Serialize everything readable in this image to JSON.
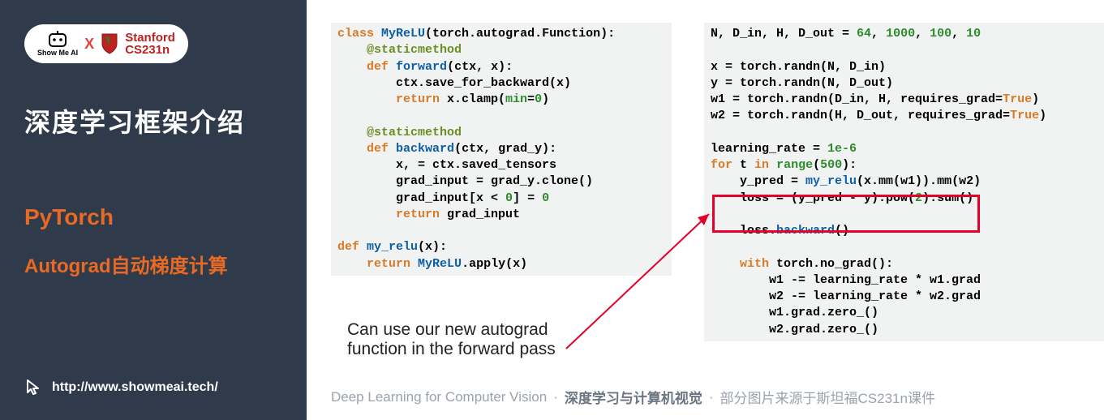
{
  "sidebar": {
    "badge": {
      "ai_small": "Show Me AI",
      "x": "X",
      "stanford_top": "Stanford",
      "stanford_bottom": "CS231n"
    },
    "title_cn": "深度学习框架介绍",
    "subtitle1": "PyTorch",
    "subtitle2": "Autograd自动梯度计算",
    "url": "http://www.showmeai.tech/"
  },
  "code_left": "class MyReLU(torch.autograd.Function):\n    @staticmethod\n    def forward(ctx, x):\n        ctx.save_for_backward(x)\n        return x.clamp(min=0)\n\n    @staticmethod\n    def backward(ctx, grad_y):\n        x, = ctx.saved_tensors\n        grad_input = grad_y.clone()\n        grad_input[x < 0] = 0\n        return grad_input\n\ndef my_relu(x):\n    return MyReLU.apply(x)",
  "code_right": "N, D_in, H, D_out = 64, 1000, 100, 10\n\nx = torch.randn(N, D_in)\ny = torch.randn(N, D_out)\nw1 = torch.randn(D_in, H, requires_grad=True)\nw2 = torch.randn(H, D_out, requires_grad=True)\n\nlearning_rate = 1e-6\nfor t in range(500):\n    y_pred = my_relu(x.mm(w1)).mm(w2)\n    loss = (y_pred - y).pow(2).sum()\n\n    loss.backward()\n\n    with torch.no_grad():\n        w1 -= learning_rate * w1.grad\n        w2 -= learning_rate * w2.grad\n        w1.grad.zero_()\n        w2.grad.zero_()",
  "caption_line1": "Can use our new autograd",
  "caption_line2": "function in the forward pass",
  "credits": {
    "c1": "Deep Learning for Computer Vision",
    "c2": "深度学习与计算机视觉",
    "c3": "部分图片来源于斯坦福CS231n课件"
  }
}
